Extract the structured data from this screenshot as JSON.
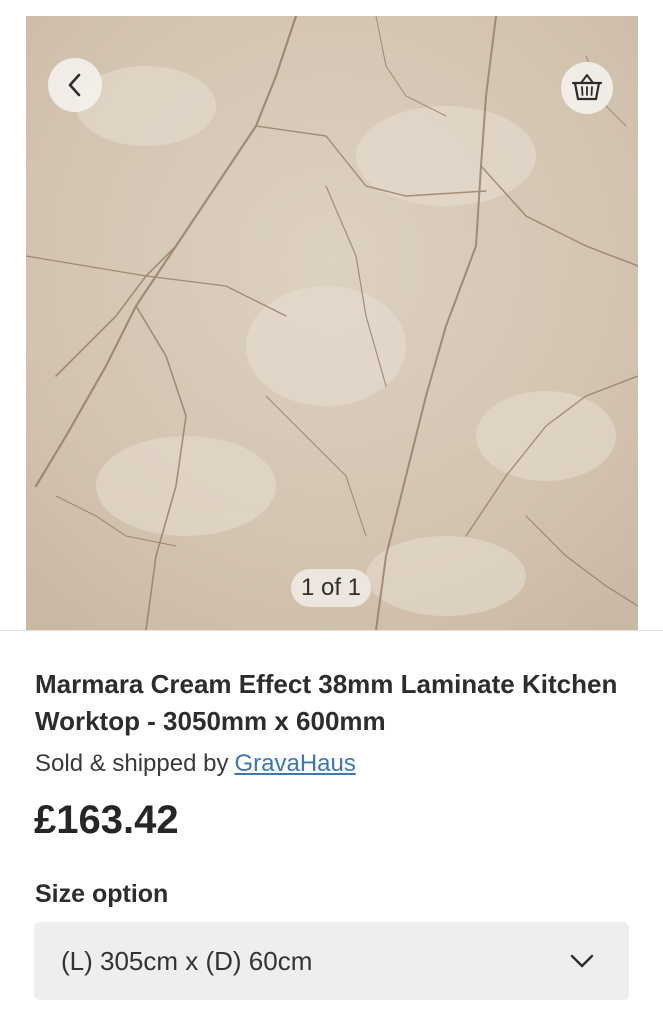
{
  "gallery": {
    "counter": "1 of 1",
    "back_icon": "chevron-left-icon",
    "basket_icon": "basket-icon"
  },
  "product": {
    "title": "Marmara Cream Effect 38mm Laminate Kitchen Worktop - 3050mm x 600mm",
    "seller_prefix": "Sold & shipped by",
    "seller_name": "GravaHaus",
    "price": "£163.42"
  },
  "size_option": {
    "label": "Size option",
    "selected": "(L) 305cm x (D) 60cm"
  },
  "colors": {
    "link": "#3b78b8",
    "select_bg": "#eeeeee"
  }
}
